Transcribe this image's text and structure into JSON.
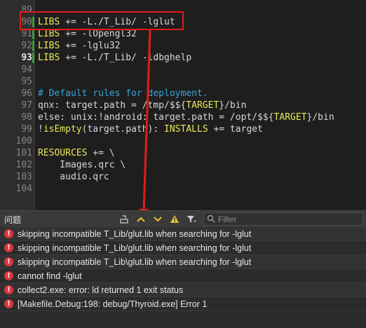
{
  "editor": {
    "lines": [
      {
        "num": "89",
        "text": ""
      },
      {
        "num": "90",
        "text": "LIBS += -L./T_Lib/ -lglut",
        "modified": true
      },
      {
        "num": "91",
        "text": "LIBS += -lOpengl32",
        "modified": true
      },
      {
        "num": "92",
        "text": "LIBS += -lglu32",
        "modified": true
      },
      {
        "num": "93",
        "text": "LIBS += -L./T_Lib/ -ldbghelp",
        "modified": true,
        "current": true
      },
      {
        "num": "94",
        "text": ""
      },
      {
        "num": "95",
        "text": ""
      },
      {
        "num": "96",
        "text": "# Default rules for deployment."
      },
      {
        "num": "97",
        "text": "qnx: target.path = /tmp/$${TARGET}/bin"
      },
      {
        "num": "98",
        "text": "else: unix:!android: target.path = /opt/$${TARGET}/bin"
      },
      {
        "num": "99",
        "text": "!isEmpty(target.path): INSTALLS += target"
      },
      {
        "num": "100",
        "text": ""
      },
      {
        "num": "101",
        "text": "RESOURCES += \\"
      },
      {
        "num": "102",
        "text": "    Images.qrc \\"
      },
      {
        "num": "103",
        "text": "    audio.qrc"
      },
      {
        "num": "104",
        "text": ""
      }
    ]
  },
  "panel": {
    "title": "问题",
    "filter_placeholder": "Filter",
    "filter_icon": "filter-icon"
  },
  "colors": {
    "error": "#d9363e",
    "annotation": "#e21b1b",
    "comment": "#3aa3d8",
    "keyword": "#e8e85a"
  },
  "issues": [
    {
      "type": "error",
      "text": "skipping incompatible T_Lib/glut.lib when searching for -lglut"
    },
    {
      "type": "error",
      "text": "skipping incompatible T_Lib/glut.lib when searching for -lglut"
    },
    {
      "type": "error",
      "text": "skipping incompatible T_Lib\\glut.lib when searching for -lglut"
    },
    {
      "type": "error",
      "text": "cannot find -lglut"
    },
    {
      "type": "error",
      "text": "collect2.exe: error: ld returned 1 exit status"
    },
    {
      "type": "error",
      "text": "[Makefile.Debug:198: debug/Thyroid.exe] Error 1"
    }
  ]
}
